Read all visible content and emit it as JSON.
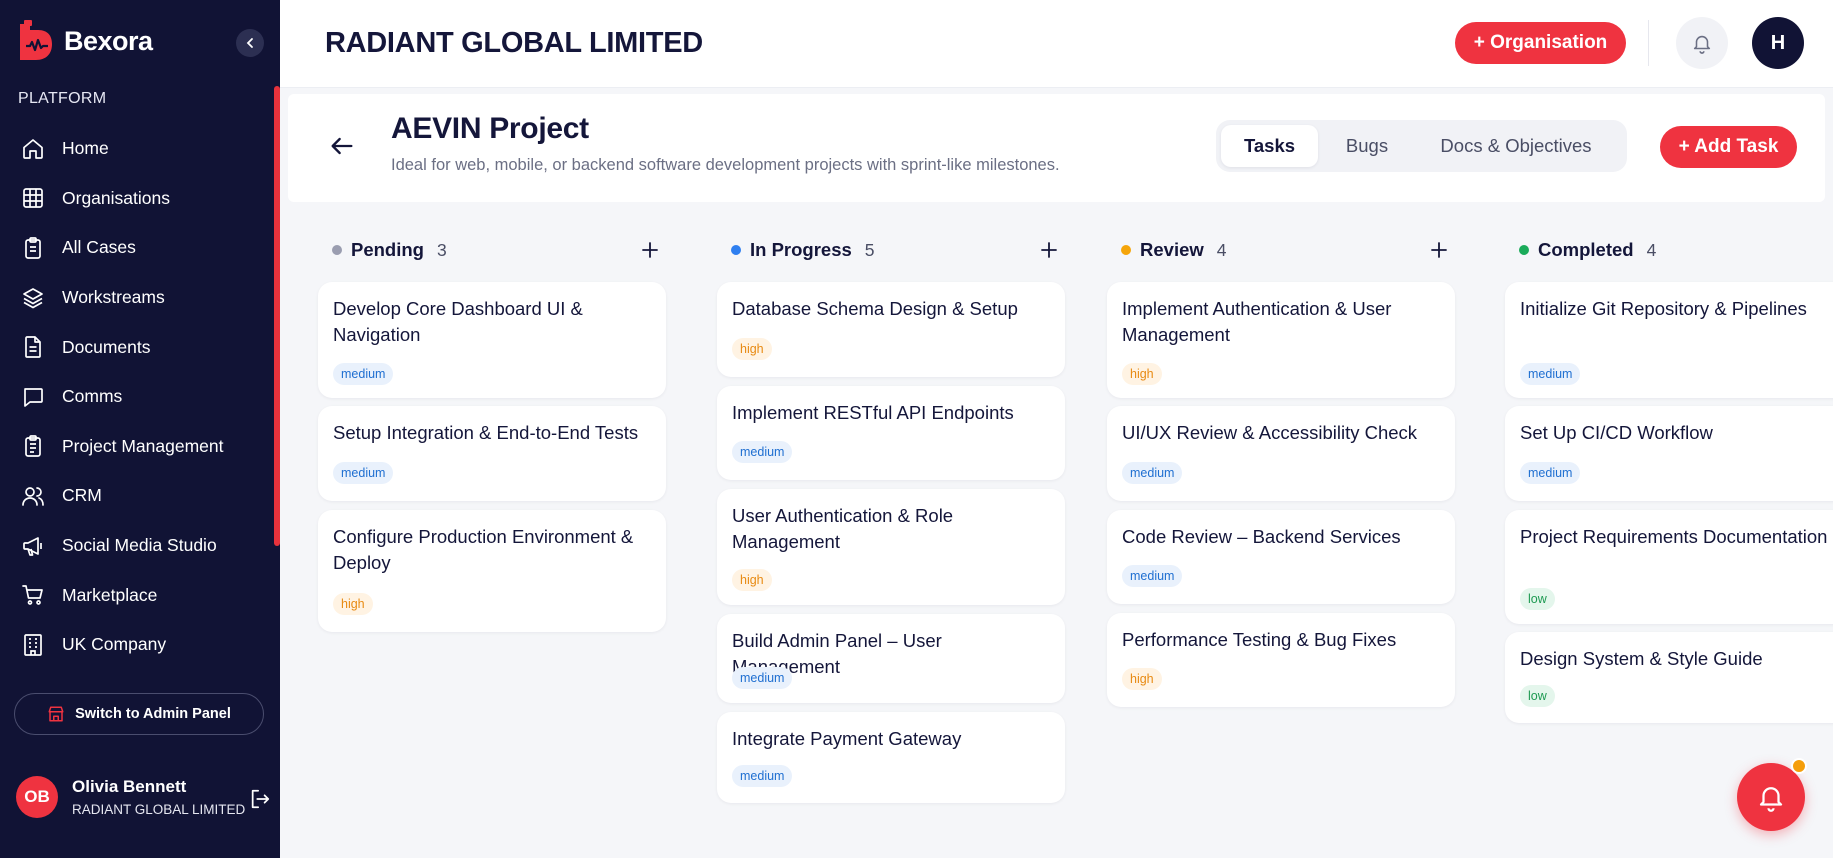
{
  "colors": {
    "accent": "#ef3340",
    "sidebar": "#111335"
  },
  "sidebar": {
    "brand": "Bexora",
    "section": "PLATFORM",
    "items": [
      {
        "label": "Home",
        "icon": "home-icon"
      },
      {
        "label": "Organisations",
        "icon": "grid-icon"
      },
      {
        "label": "All Cases",
        "icon": "clipboard-icon"
      },
      {
        "label": "Workstreams",
        "icon": "layers-icon"
      },
      {
        "label": "Documents",
        "icon": "document-icon"
      },
      {
        "label": "Comms",
        "icon": "chat-icon"
      },
      {
        "label": "Project Management",
        "icon": "clipboard-list-icon"
      },
      {
        "label": "CRM",
        "icon": "users-icon"
      },
      {
        "label": "Social Media Studio",
        "icon": "megaphone-icon"
      },
      {
        "label": "Marketplace",
        "icon": "cart-icon"
      },
      {
        "label": "UK Company",
        "icon": "building-icon"
      }
    ],
    "admin_button": "Switch to Admin Panel",
    "user": {
      "initials": "OB",
      "name": "Olivia Bennett",
      "org": "RADIANT GLOBAL LIMITED"
    }
  },
  "header": {
    "org_title": "RADIANT GLOBAL LIMITED",
    "org_button": "+ Organisation",
    "avatar_initial": "H"
  },
  "project": {
    "title": "AEVIN Project",
    "subtitle": "Ideal for web, mobile, or backend software development projects with sprint-like milestones.",
    "tabs": [
      "Tasks",
      "Bugs",
      "Docs & Objectives"
    ],
    "active_tab": "Tasks",
    "add_task": "+ Add Task"
  },
  "board": {
    "columns": [
      {
        "name": "Pending",
        "count": "3",
        "color": "#9a9db0",
        "cards": [
          {
            "title": "Develop Core Dashboard UI & Navigation",
            "priority": "medium"
          },
          {
            "title": "Setup Integration & End-to-End Tests",
            "priority": "medium"
          },
          {
            "title": "Configure Production Environment & Deploy",
            "priority": "high"
          }
        ]
      },
      {
        "name": "In Progress",
        "count": "5",
        "color": "#2f7ff0",
        "cards": [
          {
            "title": "Database Schema Design & Setup",
            "priority": "high"
          },
          {
            "title": "Implement RESTful API Endpoints",
            "priority": "medium"
          },
          {
            "title": "User Authentication & Role Management",
            "priority": "high"
          },
          {
            "title": "Build Admin Panel – User Management",
            "priority": "medium"
          },
          {
            "title": "Integrate Payment Gateway",
            "priority": "medium"
          }
        ]
      },
      {
        "name": "Review",
        "count": "4",
        "color": "#f5a50b",
        "cards": [
          {
            "title": "Implement Authentication & User Management",
            "priority": "high"
          },
          {
            "title": "UI/UX Review & Accessibility Check",
            "priority": "medium"
          },
          {
            "title": "Code Review – Backend Services",
            "priority": "medium"
          },
          {
            "title": "Performance Testing & Bug Fixes",
            "priority": "high"
          }
        ]
      },
      {
        "name": "Completed",
        "count": "4",
        "color": "#1aab5a",
        "cards": [
          {
            "title": "Initialize Git Repository & Pipelines",
            "priority": "medium"
          },
          {
            "title": "Set Up CI/CD Workflow",
            "priority": "medium"
          },
          {
            "title": "Project Requirements Documentation",
            "priority": "low"
          },
          {
            "title": "Design System & Style Guide",
            "priority": "low"
          }
        ]
      }
    ]
  }
}
